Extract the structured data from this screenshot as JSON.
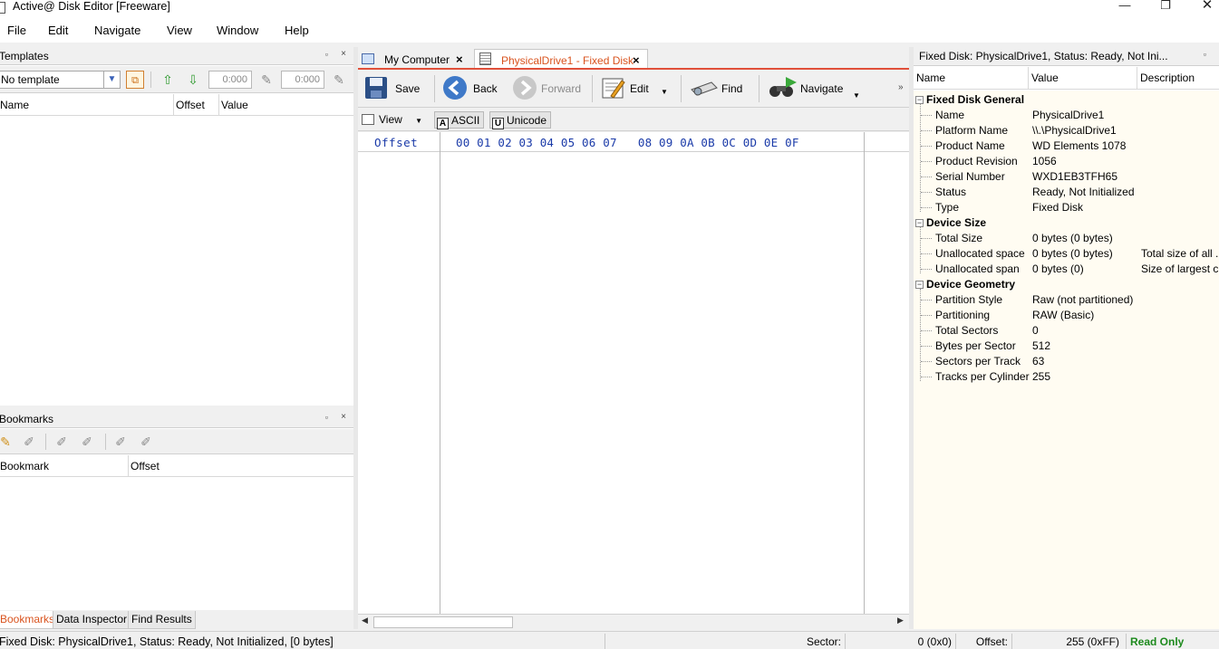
{
  "window": {
    "title": "Active@ Disk Editor [Freeware]",
    "min_glyph": "—",
    "max_glyph": "❐",
    "close_glyph": "✕"
  },
  "menu": [
    "File",
    "Edit",
    "Navigate",
    "View",
    "Window",
    "Help"
  ],
  "templates": {
    "title": "Templates",
    "pin": "▫",
    "close": "×",
    "select_value": "No template",
    "offset_from": "0:000",
    "offset_to": "0:000",
    "columns": [
      "Name",
      "Offset",
      "Value"
    ]
  },
  "bookmarks": {
    "title": "Bookmarks",
    "pin": "▫",
    "close": "×",
    "columns": [
      "Bookmark",
      "Offset"
    ]
  },
  "bottom_tabs": [
    "Bookmarks",
    "Data Inspector",
    "Find Results"
  ],
  "doc_tabs": [
    {
      "label": "My Computer",
      "close": "×"
    },
    {
      "label": "PhysicalDrive1 - Fixed Disk",
      "close": "×"
    }
  ],
  "toolbar": {
    "save": "Save",
    "back": "Back",
    "forward": "Forward",
    "edit": "Edit",
    "find": "Find",
    "navigate": "Navigate",
    "overflow": "»"
  },
  "view_bar": {
    "view": "View",
    "ascii": "ASCII",
    "ascii_letter": "A",
    "unicode": "Unicode",
    "unicode_letter": "U"
  },
  "hex": {
    "offset_label": "Offset",
    "bytes_header": "00 01 02 03 04 05 06 07   08 09 0A 0B 0C 0D 0E 0F"
  },
  "props": {
    "title": "Fixed Disk: PhysicalDrive1, Status: Ready, Not Ini...",
    "pin": "▫",
    "columns": [
      "Name",
      "Value",
      "Description"
    ],
    "groups": [
      {
        "name": "Fixed Disk General",
        "rows": [
          {
            "name": "Name",
            "value": "PhysicalDrive1",
            "desc": ""
          },
          {
            "name": "Platform Name",
            "value": "\\\\.\\PhysicalDrive1",
            "desc": ""
          },
          {
            "name": "Product Name",
            "value": "WD Elements 1078",
            "desc": ""
          },
          {
            "name": "Product Revision",
            "value": "1056",
            "desc": ""
          },
          {
            "name": "Serial Number",
            "value": "WXD1EB3TFH65",
            "desc": ""
          },
          {
            "name": "Status",
            "value": "Ready, Not Initialized",
            "desc": ""
          },
          {
            "name": "Type",
            "value": "Fixed Disk",
            "desc": ""
          }
        ]
      },
      {
        "name": "Device Size",
        "rows": [
          {
            "name": "Total Size",
            "value": "0 bytes (0 bytes)",
            "desc": ""
          },
          {
            "name": "Unallocated space",
            "value": "0 bytes (0 bytes)",
            "desc": "Total size of all ..."
          },
          {
            "name": "Unallocated span",
            "value": "0 bytes (0)",
            "desc": "Size of largest c..."
          }
        ]
      },
      {
        "name": "Device Geometry",
        "rows": [
          {
            "name": "Partition Style",
            "value": "Raw (not partitioned)",
            "desc": ""
          },
          {
            "name": "Partitioning",
            "value": "RAW (Basic)",
            "desc": ""
          },
          {
            "name": "Total Sectors",
            "value": "0",
            "desc": ""
          },
          {
            "name": "Bytes per Sector",
            "value": "512",
            "desc": ""
          },
          {
            "name": "Sectors per Track",
            "value": "63",
            "desc": ""
          },
          {
            "name": "Tracks per Cylinder",
            "value": "255",
            "desc": ""
          }
        ]
      }
    ]
  },
  "status": {
    "text": "Fixed Disk: PhysicalDrive1, Status: Ready, Not Initialized, [0 bytes]",
    "sector_label": "Sector:",
    "sector_value": "0 (0x0)",
    "offset_label": "Offset:",
    "offset_value": "255 (0xFF)",
    "mode": "Read Only"
  },
  "colors": {
    "accent_tab": "#e0503a",
    "hex_text": "#1a3aa8",
    "read_only": "#1e8a1e"
  }
}
